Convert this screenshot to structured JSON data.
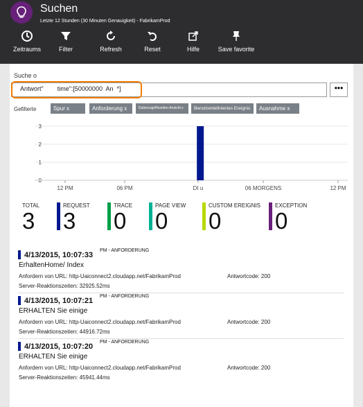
{
  "header": {
    "title": "Suchen",
    "subtitle": "Letzte 12 Stunden (30 Minuten Genauigkeit) - FabrikamProd",
    "icon": "lightbulb-icon",
    "accent_color": "#68217a"
  },
  "toolbar": [
    {
      "label": "Zeitraums",
      "icon": "clock-icon"
    },
    {
      "label": "Filter",
      "icon": "filter-icon"
    },
    {
      "label": "Refresh",
      "icon": "refresh-icon"
    },
    {
      "label": "Reset",
      "icon": "undo-icon"
    },
    {
      "label": "Hilfe",
      "icon": "external-link-icon"
    },
    {
      "label": "Save favorite",
      "icon": "pin-icon"
    }
  ],
  "search": {
    "label": "Suche o",
    "value": "Antwort\"        time\":[50000000  An  *]",
    "more_label": "•••"
  },
  "filters": {
    "label": "Gefilterte",
    "chips": [
      "Spur x",
      "Anforderung x",
      "Datenzugriffsseiten-Ansicht x",
      "Benutzerdefiniertes Ereignis",
      "Ausnahme x"
    ]
  },
  "chart_data": {
    "type": "bar",
    "x_ticks": [
      "12 PM",
      "06 PM",
      "DI u",
      "06 MORGENS",
      "12 PM"
    ],
    "y_ticks": [
      "3",
      "2",
      "1",
      "0"
    ],
    "ylim": [
      0,
      3
    ],
    "values": [
      {
        "position": 0.58,
        "value": 3
      }
    ],
    "bar_color": "#00188f",
    "grid": true
  },
  "summary": [
    {
      "label": "TOTAL",
      "value": "3",
      "color": ""
    },
    {
      "label": "REQUEST",
      "value": "3",
      "color": "#00188f"
    },
    {
      "label": "TRACE",
      "value": "0",
      "color": "#009e49"
    },
    {
      "label": "PAGE VIEW",
      "value": "0",
      "color": "#00b294"
    },
    {
      "label": "CUSTOM EREIGNIS",
      "value": "0",
      "color": "#bad80a"
    },
    {
      "label": "EXCEPTION",
      "value": "0",
      "color": "#68217a"
    }
  ],
  "results": [
    {
      "date": "4/13/2015, 10:07:33",
      "type": "PM - ANFORDERUNG",
      "name": "ErhaltenHome/ Index",
      "url": "Anfordern von URL: http-Uaiconnect2.cloudapp.net/FabrikamProd",
      "code": "Antwortcode: 200",
      "server": "Server-Reaktionszeiten: 32925.52ms"
    },
    {
      "date": "4/13/2015, 10:07:21",
      "type": "PM - ANFORDERUNG",
      "name": "ERHALTEN Sie einige",
      "url": "Anfordern von URL: http-Uaiconnect2.cloudapp.net/FabrikamProd",
      "code": "Antwortcode: 200",
      "server": "Server-Reaktionszeiten: 44916.72ms"
    },
    {
      "date": "4/13/2015, 10:07:20",
      "type": "PM - ANFORDERUNG",
      "name": "ERHALTEN Sie einige",
      "url": "Anfordern von URL: http-Uaiconnect2.cloudapp.net/FabrikamProd",
      "code": "Antwortcode: 200",
      "server": "Server-Reaktionszeiten: 45941.44ms"
    }
  ]
}
